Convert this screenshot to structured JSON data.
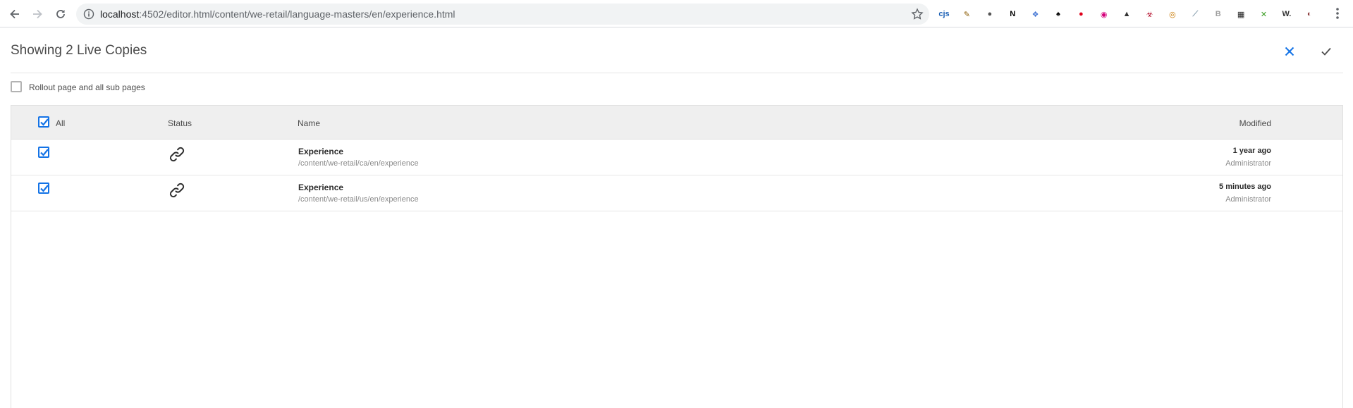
{
  "browser": {
    "url_host": "localhost",
    "url_path": ":4502/editor.html/content/we-retail/language-masters/en/experience.html",
    "extensions": [
      {
        "name": "cjs-icon",
        "glyph": "cjs",
        "color": "#1a5fb4"
      },
      {
        "name": "pen-icon",
        "glyph": "✎",
        "color": "#8a5a00"
      },
      {
        "name": "circle-icon",
        "glyph": "●",
        "color": "#555555"
      },
      {
        "name": "notion-icon",
        "glyph": "N",
        "color": "#000000"
      },
      {
        "name": "feather-icon",
        "glyph": "❖",
        "color": "#4a7bd6"
      },
      {
        "name": "spy-icon",
        "glyph": "♠",
        "color": "#000000"
      },
      {
        "name": "adblock-icon",
        "glyph": "●",
        "color": "#e0001b"
      },
      {
        "name": "target-icon",
        "glyph": "◉",
        "color": "#d4007a"
      },
      {
        "name": "drive-icon",
        "glyph": "▲",
        "color": "#333333"
      },
      {
        "name": "biohazard-icon",
        "glyph": "☣",
        "color": "#b00020"
      },
      {
        "name": "ring-icon",
        "glyph": "◎",
        "color": "#c87800"
      },
      {
        "name": "leaf-icon",
        "glyph": "⟋",
        "color": "#8aa0b0"
      },
      {
        "name": "bold-b-icon",
        "glyph": "B",
        "color": "#9e9e9e"
      },
      {
        "name": "store-icon",
        "glyph": "▦",
        "color": "#222222"
      },
      {
        "name": "arrows-icon",
        "glyph": "✕",
        "color": "#3a9d23"
      },
      {
        "name": "wappalyzer-icon",
        "glyph": "W.",
        "color": "#333333"
      },
      {
        "name": "profile-avatar-icon",
        "glyph": "◐",
        "color": "#8b3a3a"
      }
    ]
  },
  "dialog": {
    "title": "Showing 2 Live Copies",
    "close_label": "Close",
    "confirm_label": "Confirm",
    "accent_color": "#1473e6"
  },
  "rollout": {
    "label": "Rollout page and all sub pages",
    "checked": false
  },
  "table": {
    "headers": {
      "all": "All",
      "status": "Status",
      "name": "Name",
      "modified": "Modified"
    },
    "rows": [
      {
        "checked": true,
        "status_icon": "link-icon",
        "title": "Experience",
        "path": "/content/we-retail/ca/en/experience",
        "modified": "1 year ago",
        "modified_by": "Administrator"
      },
      {
        "checked": true,
        "status_icon": "link-icon",
        "title": "Experience",
        "path": "/content/we-retail/us/en/experience",
        "modified": "5 minutes ago",
        "modified_by": "Administrator"
      }
    ]
  }
}
